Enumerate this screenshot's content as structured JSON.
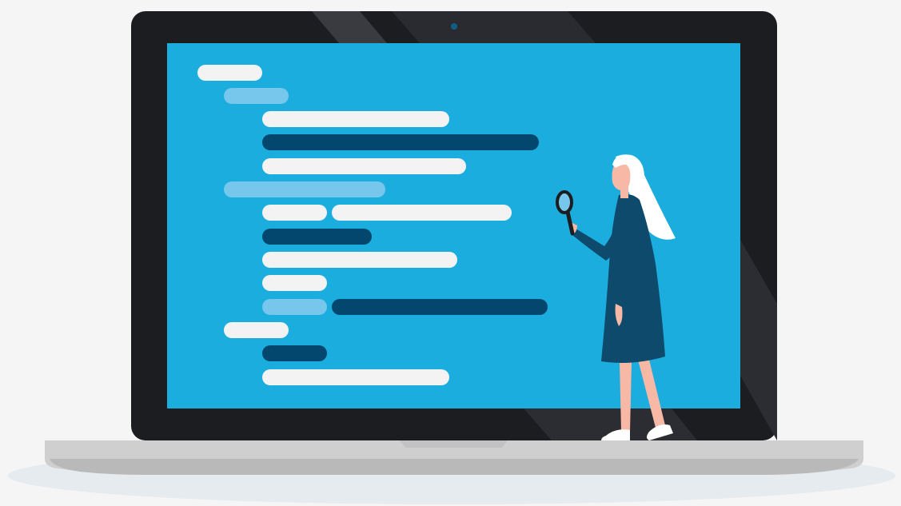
{
  "illustration": {
    "subject": "laptop-with-code-lines-and-woman-holding-magnifier",
    "code_lines": [
      {
        "indent": 0,
        "segments": [
          {
            "tone": "white",
            "length": 2
          }
        ]
      },
      {
        "indent": 1,
        "segments": [
          {
            "tone": "light-blue",
            "length": 2
          }
        ]
      },
      {
        "indent": 2,
        "segments": [
          {
            "tone": "white",
            "length": 6
          }
        ]
      },
      {
        "indent": 2,
        "segments": [
          {
            "tone": "dark-navy",
            "length": 9
          }
        ]
      },
      {
        "indent": 2,
        "segments": [
          {
            "tone": "white",
            "length": 6.5
          }
        ]
      },
      {
        "indent": 1,
        "segments": [
          {
            "tone": "light-blue",
            "length": 5
          }
        ]
      },
      {
        "indent": 2,
        "segments": [
          {
            "tone": "white",
            "length": 2
          },
          {
            "tone": "white",
            "length": 6
          }
        ]
      },
      {
        "indent": 2,
        "segments": [
          {
            "tone": "dark-navy",
            "length": 3.5
          }
        ]
      },
      {
        "indent": 2,
        "segments": [
          {
            "tone": "white",
            "length": 6
          }
        ]
      },
      {
        "indent": 2,
        "segments": [
          {
            "tone": "white",
            "length": 2
          }
        ]
      },
      {
        "indent": 2,
        "segments": [
          {
            "tone": "light-blue",
            "length": 2
          },
          {
            "tone": "dark-navy",
            "length": 7
          }
        ]
      },
      {
        "indent": 1,
        "segments": [
          {
            "tone": "white",
            "length": 2
          }
        ]
      },
      {
        "indent": 2,
        "segments": [
          {
            "tone": "dark-navy",
            "length": 2
          }
        ]
      },
      {
        "indent": 2,
        "segments": [
          {
            "tone": "white",
            "length": 6
          }
        ]
      }
    ]
  },
  "colors": {
    "background": "#f5f5f5",
    "floor_shadow": "#e6ebef",
    "laptop_frame": "#1c1d21",
    "laptop_base": "#cfcfcf",
    "laptop_base_bottom": "#b7b7b7",
    "screen": "#1badde",
    "code_white": "#f3f3f3",
    "code_light_blue": "#77c6ec",
    "code_dark_navy": "#04476e",
    "person_dress": "#0d4a6c",
    "person_skin": "#f7b8a6",
    "person_hair": "#ffffff",
    "camera": "#0e5d86"
  }
}
